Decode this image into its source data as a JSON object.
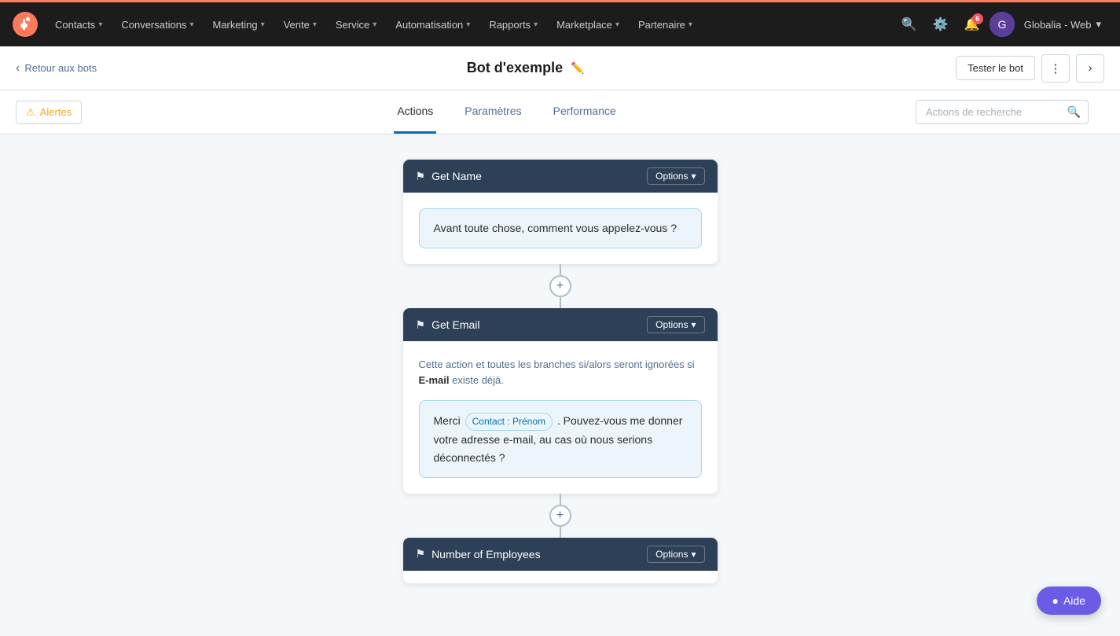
{
  "orange_bar": true,
  "nav": {
    "items": [
      {
        "label": "Contacts",
        "key": "contacts"
      },
      {
        "label": "Conversations",
        "key": "conversations"
      },
      {
        "label": "Marketing",
        "key": "marketing"
      },
      {
        "label": "Vente",
        "key": "vente"
      },
      {
        "label": "Service",
        "key": "service"
      },
      {
        "label": "Automatisation",
        "key": "automatisation"
      },
      {
        "label": "Rapports",
        "key": "rapports"
      },
      {
        "label": "Marketplace",
        "key": "marketplace"
      },
      {
        "label": "Partenaire",
        "key": "partenaire"
      }
    ],
    "notification_count": "6",
    "user_label": "Globalia - Web"
  },
  "subheader": {
    "back_label": "Retour aux bots",
    "title": "Bot d'exemple",
    "test_bot_label": "Tester le bot"
  },
  "tabs": {
    "alert_label": "Alertes",
    "items": [
      {
        "label": "Actions",
        "key": "actions",
        "active": true
      },
      {
        "label": "Paramètres",
        "key": "parametres",
        "active": false
      },
      {
        "label": "Performance",
        "key": "performance",
        "active": false
      }
    ],
    "search_placeholder": "Actions de recherche"
  },
  "nodes": [
    {
      "id": "get-name",
      "title": "Get Name",
      "options_label": "Options",
      "message": "Avant toute chose, comment vous appelez-vous ?"
    },
    {
      "id": "get-email",
      "title": "Get Email",
      "options_label": "Options",
      "info_part1": "Cette action et toutes les branches si/alors seront ignorées si ",
      "info_bold": "E-mail",
      "info_part2": " existe déjà.",
      "message_part1": "Merci",
      "token_label": "Contact : Prénom",
      "message_part2": ". Pouvez-vous me donner votre adresse e-mail, au cas où nous serions déconnectés ?"
    },
    {
      "id": "number-of-employees",
      "title": "Number of Employees",
      "options_label": "Options"
    }
  ],
  "help_label": "Aide"
}
